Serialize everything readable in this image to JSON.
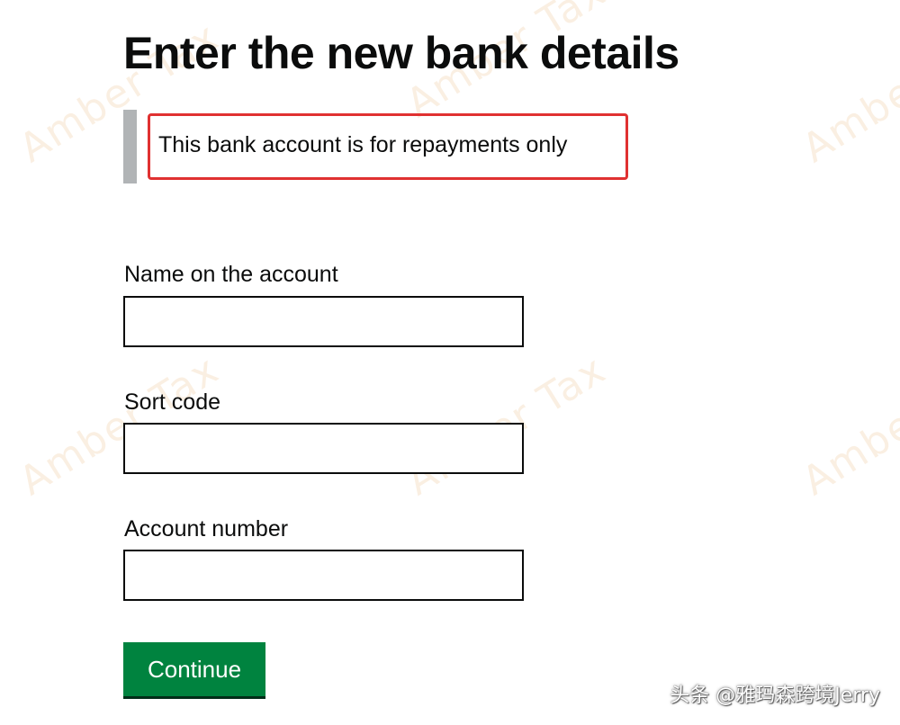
{
  "page": {
    "title": "Enter the new bank details",
    "inset_text": "This bank account is for repayments only"
  },
  "form": {
    "fields": [
      {
        "label": "Name on the account",
        "value": ""
      },
      {
        "label": "Sort code",
        "value": ""
      },
      {
        "label": "Account number",
        "value": ""
      }
    ],
    "continue_label": "Continue"
  },
  "watermark": {
    "text": "Amber Tax"
  },
  "overlay": {
    "source_credit": "头条 @雅玛森跨境Jerry"
  },
  "colors": {
    "button_green": "#00833f",
    "highlight_red": "#e03131",
    "inset_border_grey": "#b1b4b6",
    "text": "#0b0c0c"
  }
}
